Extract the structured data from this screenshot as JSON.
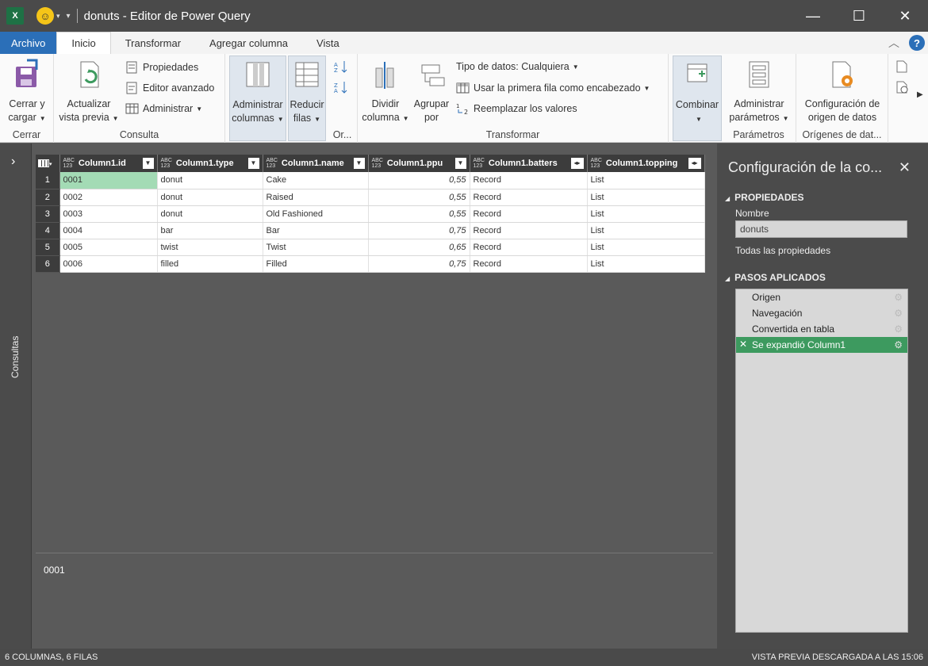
{
  "window": {
    "title": "donuts - Editor de Power Query",
    "app_icon": "X",
    "minimize": "—",
    "maximize": "☐",
    "close": "✕"
  },
  "tabs": [
    {
      "label": "Archivo"
    },
    {
      "label": "Inicio"
    },
    {
      "label": "Transformar"
    },
    {
      "label": "Agregar columna"
    },
    {
      "label": "Vista"
    }
  ],
  "ribbon": {
    "cerrar": {
      "btn": "Cerrar y cargar",
      "line1": "Cerrar y",
      "line2": "cargar",
      "group": "Cerrar"
    },
    "consulta": {
      "actualizar_line1": "Actualizar",
      "actualizar_line2": "vista previa",
      "propiedades": "Propiedades",
      "editor": "Editor avanzado",
      "administrar": "Administrar",
      "group": "Consulta"
    },
    "administrar_columnas": {
      "line1": "Administrar",
      "line2": "columnas"
    },
    "reducir_filas": {
      "line1": "Reducir",
      "line2": "filas"
    },
    "ordenar_group": "Or...",
    "transformar": {
      "dividir_line1": "Dividir",
      "dividir_line2": "columna",
      "agrupar_line1": "Agrupar",
      "agrupar_line2": "por",
      "tipo_datos": "Tipo de datos: Cualquiera",
      "primera_fila": "Usar la primera fila como encabezado",
      "reemplazar": "Reemplazar los valores",
      "group": "Transformar"
    },
    "combinar": {
      "label": "Combinar"
    },
    "parametros": {
      "line1": "Administrar",
      "line2": "parámetros",
      "group": "Parámetros"
    },
    "origenes": {
      "line1": "Configuración de",
      "line2": "origen de datos",
      "group": "Orígenes de dat..."
    }
  },
  "leftnav": {
    "label": "Consultas"
  },
  "grid": {
    "columns": [
      {
        "name": "Column1.id",
        "type_top": "ABC",
        "type_bottom": "123"
      },
      {
        "name": "Column1.type",
        "type_top": "ABC",
        "type_bottom": "123"
      },
      {
        "name": "Column1.name",
        "type_top": "ABC",
        "type_bottom": "123"
      },
      {
        "name": "Column1.ppu",
        "type_top": "ABC",
        "type_bottom": "123"
      },
      {
        "name": "Column1.batters",
        "type_top": "ABC",
        "type_bottom": "123"
      },
      {
        "name": "Column1.topping",
        "type_top": "ABC",
        "type_bottom": "123"
      }
    ],
    "rows": [
      {
        "n": "1",
        "id": "0001",
        "type": "donut",
        "name": "Cake",
        "ppu": "0,55",
        "batters": "Record",
        "topping": "List"
      },
      {
        "n": "2",
        "id": "0002",
        "type": "donut",
        "name": "Raised",
        "ppu": "0,55",
        "batters": "Record",
        "topping": "List"
      },
      {
        "n": "3",
        "id": "0003",
        "type": "donut",
        "name": "Old Fashioned",
        "ppu": "0,55",
        "batters": "Record",
        "topping": "List"
      },
      {
        "n": "4",
        "id": "0004",
        "type": "bar",
        "name": "Bar",
        "ppu": "0,75",
        "batters": "Record",
        "topping": "List"
      },
      {
        "n": "5",
        "id": "0005",
        "type": "twist",
        "name": "Twist",
        "ppu": "0,65",
        "batters": "Record",
        "topping": "List"
      },
      {
        "n": "6",
        "id": "0006",
        "type": "filled",
        "name": "Filled",
        "ppu": "0,75",
        "batters": "Record",
        "topping": "List"
      }
    ],
    "selected_cell_value": "0001"
  },
  "settings": {
    "title": "Configuración de la co...",
    "properties_header": "PROPIEDADES",
    "name_label": "Nombre",
    "name_value": "donuts",
    "all_properties": "Todas las propiedades",
    "steps_header": "PASOS APLICADOS",
    "steps": [
      {
        "label": "Origen"
      },
      {
        "label": "Navegación"
      },
      {
        "label": "Convertida en tabla"
      },
      {
        "label": "Se expandió Column1"
      }
    ]
  },
  "status": {
    "left": "6 COLUMNAS, 6 FILAS",
    "right": "VISTA PREVIA DESCARGADA A LAS 15:06"
  },
  "colors": {
    "accent_blue": "#2b6fb8",
    "step_active": "#3d9a5f",
    "selected_cell": "#a3dbb5",
    "link_green": "#1a7a1a"
  }
}
